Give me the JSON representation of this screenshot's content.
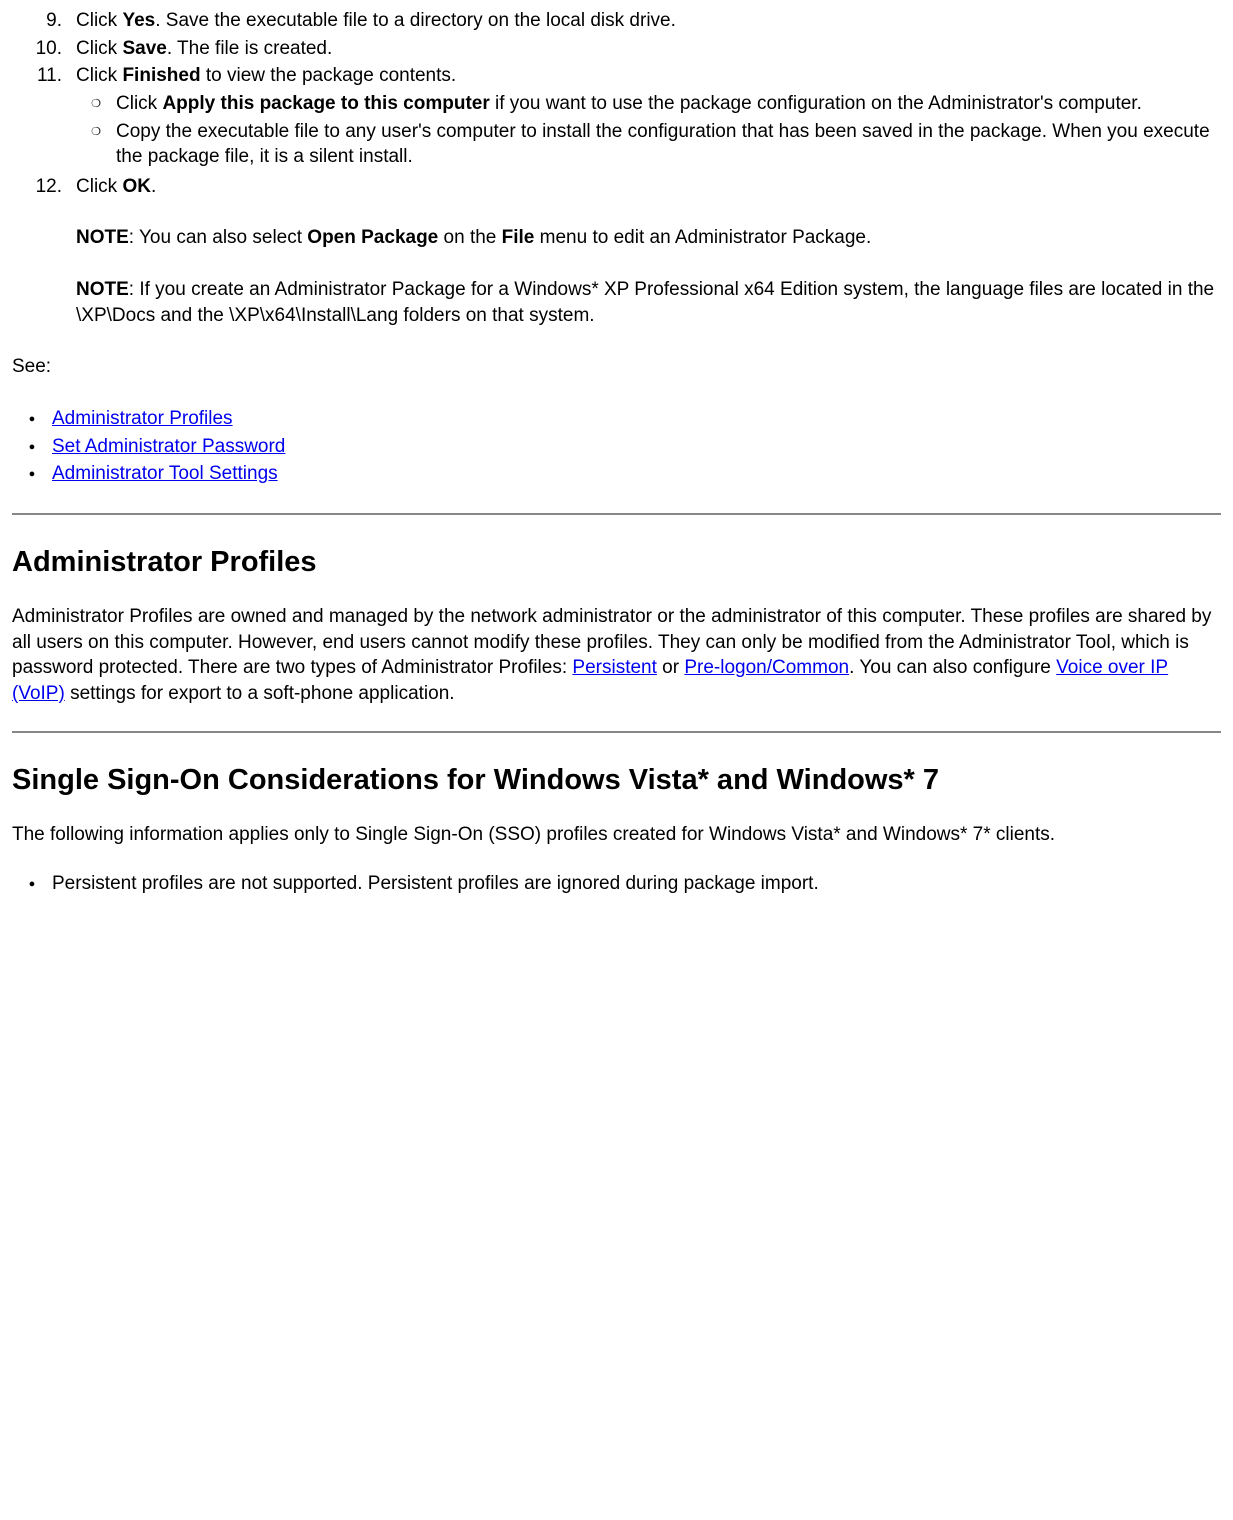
{
  "steps": {
    "s9": {
      "num": "9.",
      "pre": "Click ",
      "bold": "Yes",
      "post": ". Save the executable file to a directory on the local disk drive."
    },
    "s10": {
      "num": "10.",
      "pre": "Click ",
      "bold": "Save",
      "post": ". The file is created."
    },
    "s11": {
      "num": "11.",
      "pre": "Click ",
      "bold": "Finished",
      "post": " to view the package contents."
    },
    "s11a": {
      "pre": "Click ",
      "bold": "Apply this package to this computer",
      "post": " if you want to use the package configuration on the Administrator's computer."
    },
    "s11b": {
      "text": "Copy the executable file to any user's computer to install the configuration that has been saved in the package. When you execute the package file, it is a silent install."
    },
    "s12": {
      "num": "12.",
      "pre": "Click ",
      "bold": "OK",
      "post": "."
    },
    "note1": {
      "label": "NOTE",
      "pre": ": You can also select ",
      "b1": "Open Package",
      "mid": " on the ",
      "b2": "File",
      "post": " menu to edit an Administrator Package."
    },
    "note2": {
      "label": "NOTE",
      "text": ": If you create an Administrator Package for a Windows* XP Professional x64 Edition system, the language files are located in the \\XP\\Docs and the \\XP\\x64\\Install\\Lang folders on that system."
    }
  },
  "see": {
    "label": "See:",
    "links": {
      "l1": "Administrator Profiles",
      "l2": "Set Administrator Password",
      "l3": "Administrator Tool Settings"
    }
  },
  "section1": {
    "heading": "Administrator Profiles",
    "p1a": "Administrator Profiles are owned and managed by the network administrator or the administrator of this computer. These profiles are shared by all users on this computer. However, end users cannot modify these profiles. They can only be modified from the Administrator Tool, which is password protected. There are two types of Administrator Profiles: ",
    "link1": "Persistent",
    "p1b": " or ",
    "link2": "Pre-logon/Common",
    "p1c": ". You can also configure ",
    "link3": "Voice over IP (VoIP)",
    "p1d": " settings for export to a soft-phone application."
  },
  "section2": {
    "heading": "Single Sign-On Considerations for Windows Vista* and Windows* 7",
    "p1": "The following information applies only to Single Sign-On (SSO) profiles created for Windows Vista* and Windows* 7* clients.",
    "bullet1": "Persistent profiles are not supported. Persistent profiles are ignored during package import."
  }
}
